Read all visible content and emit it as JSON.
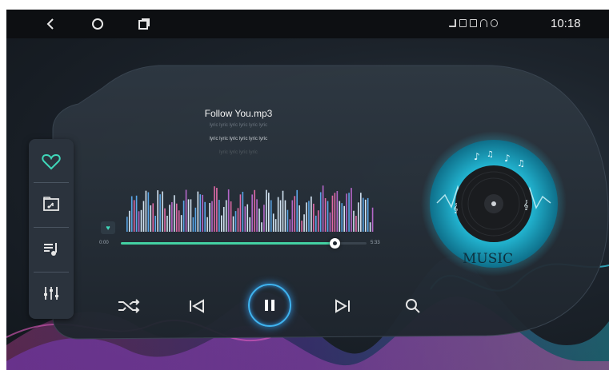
{
  "status_bar": {
    "nav": [
      "back-icon",
      "home-icon",
      "recents-icon"
    ],
    "indicators": [
      "signal-icon",
      "sim-icon",
      "battery-icon",
      "wifi-icon",
      "phone-icon"
    ],
    "time": "10:18"
  },
  "player": {
    "title": "Follow You.mp3",
    "lyrics": [
      "lyric lyric lyric lyric lyric lyric",
      "lyric lyric lyric lyric lyric lyric",
      "lyric lyric lyric lyric"
    ],
    "time_elapsed": "0:00",
    "time_total": "5:33",
    "progress": 0.87
  },
  "sidebar": {
    "items": [
      "favorite-icon",
      "folder-music-icon",
      "playlist-icon",
      "equalizer-icon"
    ]
  },
  "controls": [
    "shuffle-icon",
    "previous-icon",
    "pause-icon",
    "next-icon",
    "search-icon"
  ],
  "album_art": {
    "word": "MUSIC"
  },
  "colors": {
    "accent_green": "#43d0a2",
    "heart_teal": "#3fd7b9",
    "play_ring": "#3fb4f0",
    "disc_cyan": "#22b4d0"
  }
}
